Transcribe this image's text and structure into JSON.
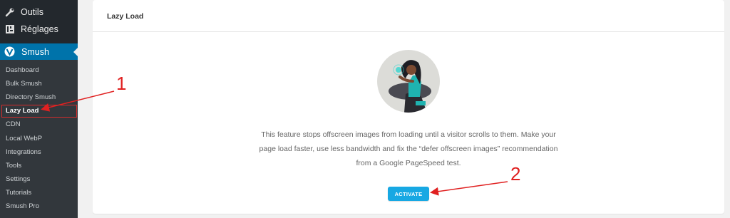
{
  "sidebar": {
    "top_items": [
      {
        "label": "Outils",
        "icon": "wrench-icon"
      },
      {
        "label": "Réglages",
        "icon": "settings-grid-icon"
      }
    ],
    "smush": {
      "label": "Smush",
      "icon": "smush-logo-icon"
    },
    "submenu": [
      {
        "label": "Dashboard"
      },
      {
        "label": "Bulk Smush"
      },
      {
        "label": "Directory Smush"
      },
      {
        "label": "Lazy Load",
        "active": true
      },
      {
        "label": "CDN"
      },
      {
        "label": "Local WebP"
      },
      {
        "label": "Integrations"
      },
      {
        "label": "Tools"
      },
      {
        "label": "Settings"
      },
      {
        "label": "Tutorials"
      },
      {
        "label": "Smush Pro"
      }
    ]
  },
  "card": {
    "title": "Lazy Load",
    "description_lines": [
      "This feature stops offscreen images from loading until a visitor scrolls to them. Make your",
      "page load faster, use less bandwidth and fix the “defer offscreen images” recommendation",
      "from a Google PageSpeed test."
    ],
    "activate_label": "ACTIVATE"
  },
  "annotations": {
    "step1": "1",
    "step2": "2",
    "color": "#e02020"
  },
  "colors": {
    "sidebar_bg": "#23282d",
    "submenu_bg": "#32373c",
    "active_menu": "#0073aa",
    "button": "#17a8e3"
  }
}
